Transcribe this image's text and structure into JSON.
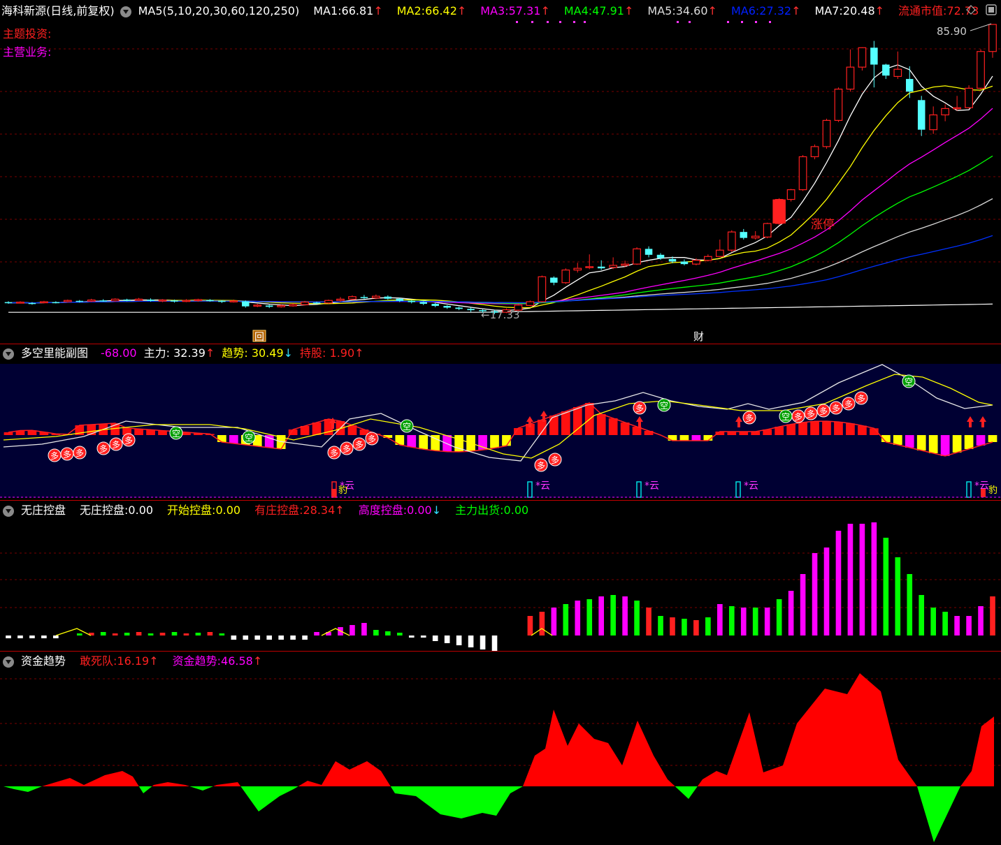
{
  "main": {
    "title": "海科新源(日线,前复权)",
    "params": "MA5(5,10,20,30,60,120,250)",
    "ma": [
      {
        "label": "MA1:",
        "value": "66.81",
        "dir": "up",
        "color": "#ffffff"
      },
      {
        "label": "MA2:",
        "value": "66.42",
        "dir": "up",
        "color": "#ffff00"
      },
      {
        "label": "MA3:",
        "value": "57.31",
        "dir": "up",
        "color": "#ff00ff"
      },
      {
        "label": "MA4:",
        "value": "47.91",
        "dir": "up",
        "color": "#00ff00"
      },
      {
        "label": "MA5:",
        "value": "34.60",
        "dir": "up",
        "color": "#dddddd"
      },
      {
        "label": "MA6:",
        "value": "27.32",
        "dir": "up",
        "color": "#0020ff"
      },
      {
        "label": "MA7:",
        "value": "20.48",
        "dir": "up",
        "color": "#ffffff"
      }
    ],
    "market_cap_label": "流通市值:",
    "market_cap_value": "72.73",
    "theme_label": "主题投资:",
    "business_label": "主营业务:",
    "high_label": "85.90",
    "low_label": "←17.33",
    "limit_up_label": "涨停",
    "marker_hui": "回",
    "marker_cai": "财"
  },
  "sub1": {
    "title": "多空里能副图",
    "v0": "-68.00",
    "zhuli_label": "主力:",
    "zhuli_value": "32.39",
    "qushi_label": "趋势:",
    "qushi_value": "30.49",
    "chigu_label": "持股:",
    "chigu_value": "1.90",
    "duo": "多",
    "kong": "空",
    "yun": "*云",
    "bao": "豹"
  },
  "sub2": {
    "title": "无庄控盘",
    "items": [
      {
        "label": "无庄控盘:",
        "value": "0.00",
        "dir": "",
        "color": "#ffffff"
      },
      {
        "label": "开始控盘:",
        "value": "0.00",
        "dir": "",
        "color": "#ffff00"
      },
      {
        "label": "有庄控盘:",
        "value": "28.34",
        "dir": "up",
        "color": "#ff2020"
      },
      {
        "label": "高度控盘:",
        "value": "0.00",
        "dir": "down",
        "color": "#ff00ff"
      },
      {
        "label": "主力出货:",
        "value": "0.00",
        "dir": "",
        "color": "#00ff00"
      }
    ]
  },
  "sub3": {
    "title": "资金趋势",
    "items": [
      {
        "label": "敢死队:",
        "value": "16.19",
        "dir": "up",
        "color": "#ff2020"
      },
      {
        "label": "资金趋势:",
        "value": "46.58",
        "dir": "up",
        "color": "#ff00ff"
      }
    ]
  },
  "arrows": {
    "up": "↑",
    "down": "↓"
  }
}
